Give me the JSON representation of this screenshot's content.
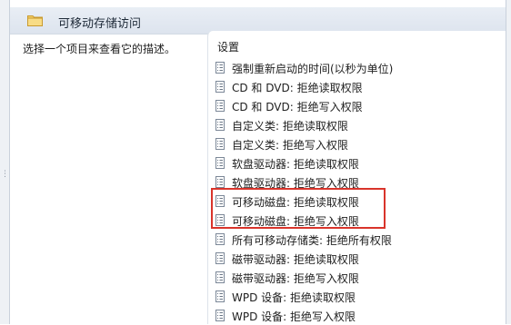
{
  "header": {
    "title": "可移动存储访问"
  },
  "description_pane": {
    "text": "选择一个项目来查看它的描述。"
  },
  "list": {
    "column_header": "设置",
    "items": [
      {
        "label": "强制重新启动的时间(以秒为单位)"
      },
      {
        "label": "CD 和 DVD: 拒绝读取权限"
      },
      {
        "label": "CD 和 DVD: 拒绝写入权限"
      },
      {
        "label": "自定义类: 拒绝读取权限"
      },
      {
        "label": "自定义类: 拒绝写入权限"
      },
      {
        "label": "软盘驱动器: 拒绝读取权限"
      },
      {
        "label": "软盘驱动器: 拒绝写入权限"
      },
      {
        "label": "可移动磁盘: 拒绝读取权限"
      },
      {
        "label": "可移动磁盘: 拒绝写入权限"
      },
      {
        "label": "所有可移动存储类: 拒绝所有权限"
      },
      {
        "label": "磁带驱动器: 拒绝读取权限"
      },
      {
        "label": "磁带驱动器: 拒绝写入权限"
      },
      {
        "label": "WPD 设备: 拒绝读取权限"
      },
      {
        "label": "WPD 设备: 拒绝写入权限"
      }
    ]
  },
  "annotation": {
    "highlight_color": "#d9342b",
    "highlighted_items": [
      7,
      8
    ]
  },
  "icons": {
    "folder": "folder-icon",
    "setting": "policy-setting-icon"
  }
}
